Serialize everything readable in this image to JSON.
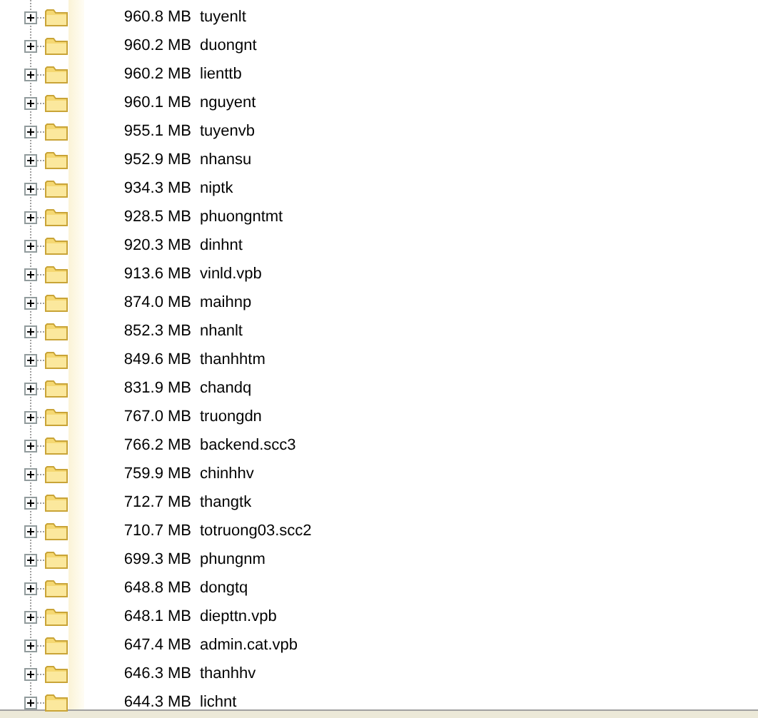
{
  "rows": [
    {
      "size": "960.8 MB",
      "name": "tuyenlt",
      "expanded": false
    },
    {
      "size": "960.2 MB",
      "name": "duongnt",
      "expanded": false
    },
    {
      "size": "960.2 MB",
      "name": "lienttb",
      "expanded": false
    },
    {
      "size": "960.1 MB",
      "name": "nguyent",
      "expanded": false
    },
    {
      "size": "955.1 MB",
      "name": "tuyenvb",
      "expanded": false
    },
    {
      "size": "952.9 MB",
      "name": "nhansu",
      "expanded": false
    },
    {
      "size": "934.3 MB",
      "name": "niptk",
      "expanded": false
    },
    {
      "size": "928.5 MB",
      "name": "phuongntmt",
      "expanded": false
    },
    {
      "size": "920.3 MB",
      "name": "dinhnt",
      "expanded": false
    },
    {
      "size": "913.6 MB",
      "name": "vinld.vpb",
      "expanded": false
    },
    {
      "size": "874.0 MB",
      "name": "maihnp",
      "expanded": false
    },
    {
      "size": "852.3 MB",
      "name": "nhanlt",
      "expanded": false
    },
    {
      "size": "849.6 MB",
      "name": "thanhhtm",
      "expanded": false
    },
    {
      "size": "831.9 MB",
      "name": "chandq",
      "expanded": false
    },
    {
      "size": "767.0 MB",
      "name": "truongdn",
      "expanded": false
    },
    {
      "size": "766.2 MB",
      "name": "backend.scc3",
      "expanded": false
    },
    {
      "size": "759.9 MB",
      "name": "chinhhv",
      "expanded": false
    },
    {
      "size": "712.7 MB",
      "name": "thangtk",
      "expanded": false
    },
    {
      "size": "710.7 MB",
      "name": "totruong03.scc2",
      "expanded": false
    },
    {
      "size": "699.3 MB",
      "name": "phungnm",
      "expanded": false
    },
    {
      "size": "648.8 MB",
      "name": "dongtq",
      "expanded": false
    },
    {
      "size": "648.1 MB",
      "name": "diepttn.vpb",
      "expanded": false
    },
    {
      "size": "647.4 MB",
      "name": "admin.cat.vpb",
      "expanded": false
    },
    {
      "size": "646.3 MB",
      "name": "thanhhv",
      "expanded": false
    },
    {
      "size": "644.3 MB",
      "name": "lichnt",
      "expanded": false
    }
  ]
}
